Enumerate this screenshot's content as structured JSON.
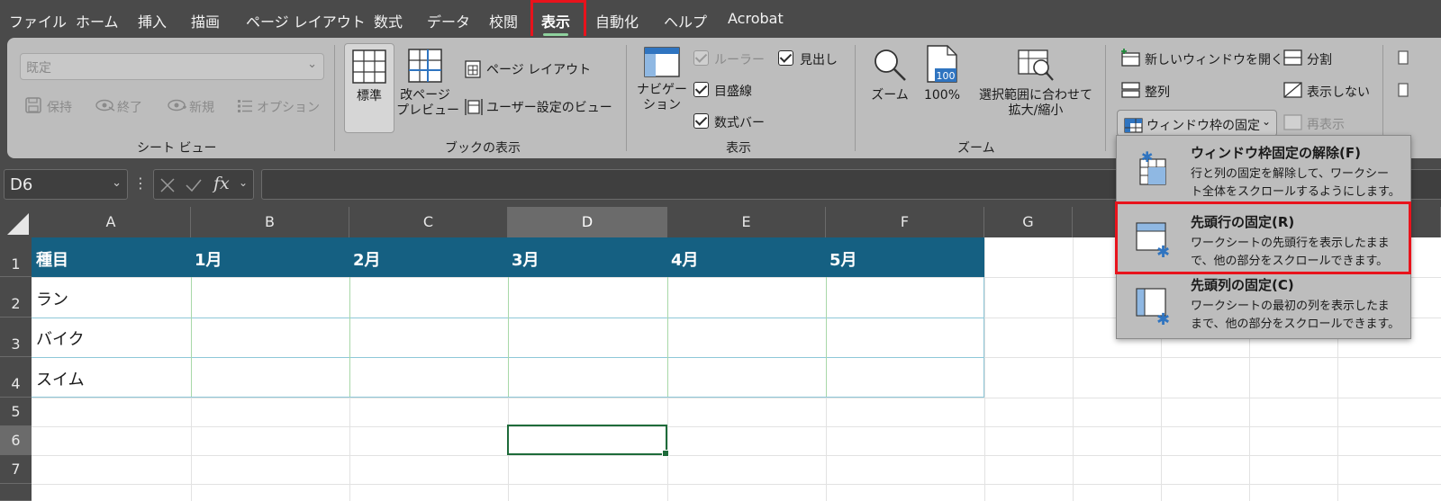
{
  "menu": {
    "tabs": [
      "ファイル",
      "ホーム",
      "挿入",
      "描画",
      "ページ レイアウト",
      "数式",
      "データ",
      "校閲",
      "表示",
      "自動化",
      "ヘルプ",
      "Acrobat"
    ],
    "active": "表示"
  },
  "ribbon": {
    "sheet_view": {
      "select_value": "既定",
      "keep": "保持",
      "exit": "終了",
      "new": "新規",
      "options": "オプション",
      "label": "シート ビュー"
    },
    "workbook_views": {
      "normal": "標準",
      "page_break_1": "改ページ",
      "page_break_2": "プレビュー",
      "page_layout": "ページ レイアウト",
      "custom_views": "ユーザー設定のビュー",
      "label": "ブックの表示"
    },
    "show": {
      "navigation_1": "ナビゲー",
      "navigation_2": "ション",
      "ruler": "ルーラー",
      "gridlines": "目盛線",
      "formula_bar": "数式バー",
      "headings": "見出し",
      "label": "表示"
    },
    "zoom": {
      "zoom": "ズーム",
      "zoom_100": "100%",
      "zoom_100_icon_text": "100",
      "zoom_selection_1": "選択範囲に合わせて",
      "zoom_selection_2": "拡大/縮小",
      "label": "ズーム"
    },
    "window": {
      "new_window": "新しいウィンドウを開く",
      "arrange": "整列",
      "freeze_panes": "ウィンドウ枠の固定",
      "split": "分割",
      "hide": "表示しない",
      "unhide": "再表示"
    }
  },
  "formula_bar": {
    "name_box": "D6",
    "fx": "fx",
    "formula": ""
  },
  "grid": {
    "columns": [
      "A",
      "B",
      "C",
      "D",
      "E",
      "F",
      "G"
    ],
    "rows": [
      "1",
      "2",
      "3",
      "4",
      "5",
      "6",
      "7"
    ],
    "header_cells": [
      "種目",
      "1月",
      "2月",
      "3月",
      "4月",
      "5月"
    ],
    "body_cells": [
      "ラン",
      "バイク",
      "スイム"
    ],
    "active_cell": "D6"
  },
  "freeze_menu": {
    "items": [
      {
        "title": "ウィンドウ枠固定の解除(F)",
        "desc1": "行と列の固定を解除して、ワークシー",
        "desc2": "ト全体をスクロールするようにします。"
      },
      {
        "title": "先頭行の固定(R)",
        "desc1": "ワークシートの先頭行を表示したまま",
        "desc2": "で、他の部分をスクロールできます。"
      },
      {
        "title": "先頭列の固定(C)",
        "desc1": "ワークシートの最初の列を表示したま",
        "desc2": "まで、他の部分をスクロールできます。"
      }
    ]
  },
  "colors": {
    "table_header": "#156082",
    "highlight": "#e8131c",
    "menu_bg": "#4a4a4a",
    "ribbon_bg": "#bdbdbd"
  }
}
